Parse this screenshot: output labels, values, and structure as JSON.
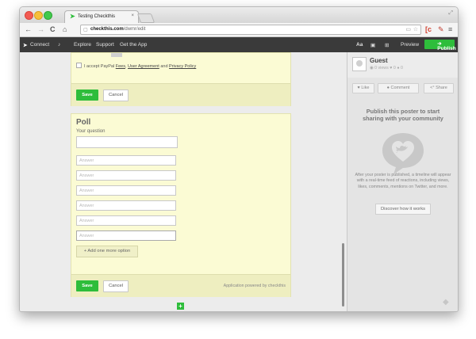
{
  "browser": {
    "tab_title": "Testing Checkthis",
    "tab_close": "×",
    "url_domain": "checkthis.com",
    "url_path": "/dwmr/edit",
    "resize_glyph": "⤢"
  },
  "nav": {
    "back": "←",
    "forward": "→",
    "reload": "C",
    "home": "⌂"
  },
  "appnav": {
    "connect": "Connect",
    "explore": "Explore",
    "support": "Support",
    "get_app": "Get the App",
    "preview": "Preview",
    "publish": "Publish",
    "text_tool": "Aa"
  },
  "card1": {
    "accept_prefix": "I accept PayPal",
    "fees": "Fees",
    "user_agreement": "User Agreement",
    "and": "and",
    "privacy": "Privacy Policy",
    "save": "Save",
    "cancel": "Cancel"
  },
  "poll": {
    "title": "Poll",
    "question_label": "Your question",
    "answers": [
      "Answer",
      "Answer",
      "Answer",
      "Answer",
      "Answer",
      "Answer"
    ],
    "add_option": "+ Add one more option",
    "save": "Save",
    "cancel": "Cancel",
    "powered_by": "Application powered by checkthis"
  },
  "sidebar": {
    "guest_name": "Guest",
    "stats": {
      "views": "0 views",
      "likes": "0",
      "comments": "0"
    },
    "actions": {
      "like": "Like",
      "comment": "Comment",
      "share": "Share"
    },
    "publish_text": "Publish this poster to start sharing with your community",
    "after_text": "After your poster is published, a timeline will appear with a real-time feed of reactions, including views, likes, comments, mentions on Twitter, and more.",
    "discover": "Discover how it works"
  },
  "colors": {
    "brand_green": "#2ebd3b",
    "nav_dark": "#3a3a3a",
    "card_yellow": "#fbfbd4"
  }
}
